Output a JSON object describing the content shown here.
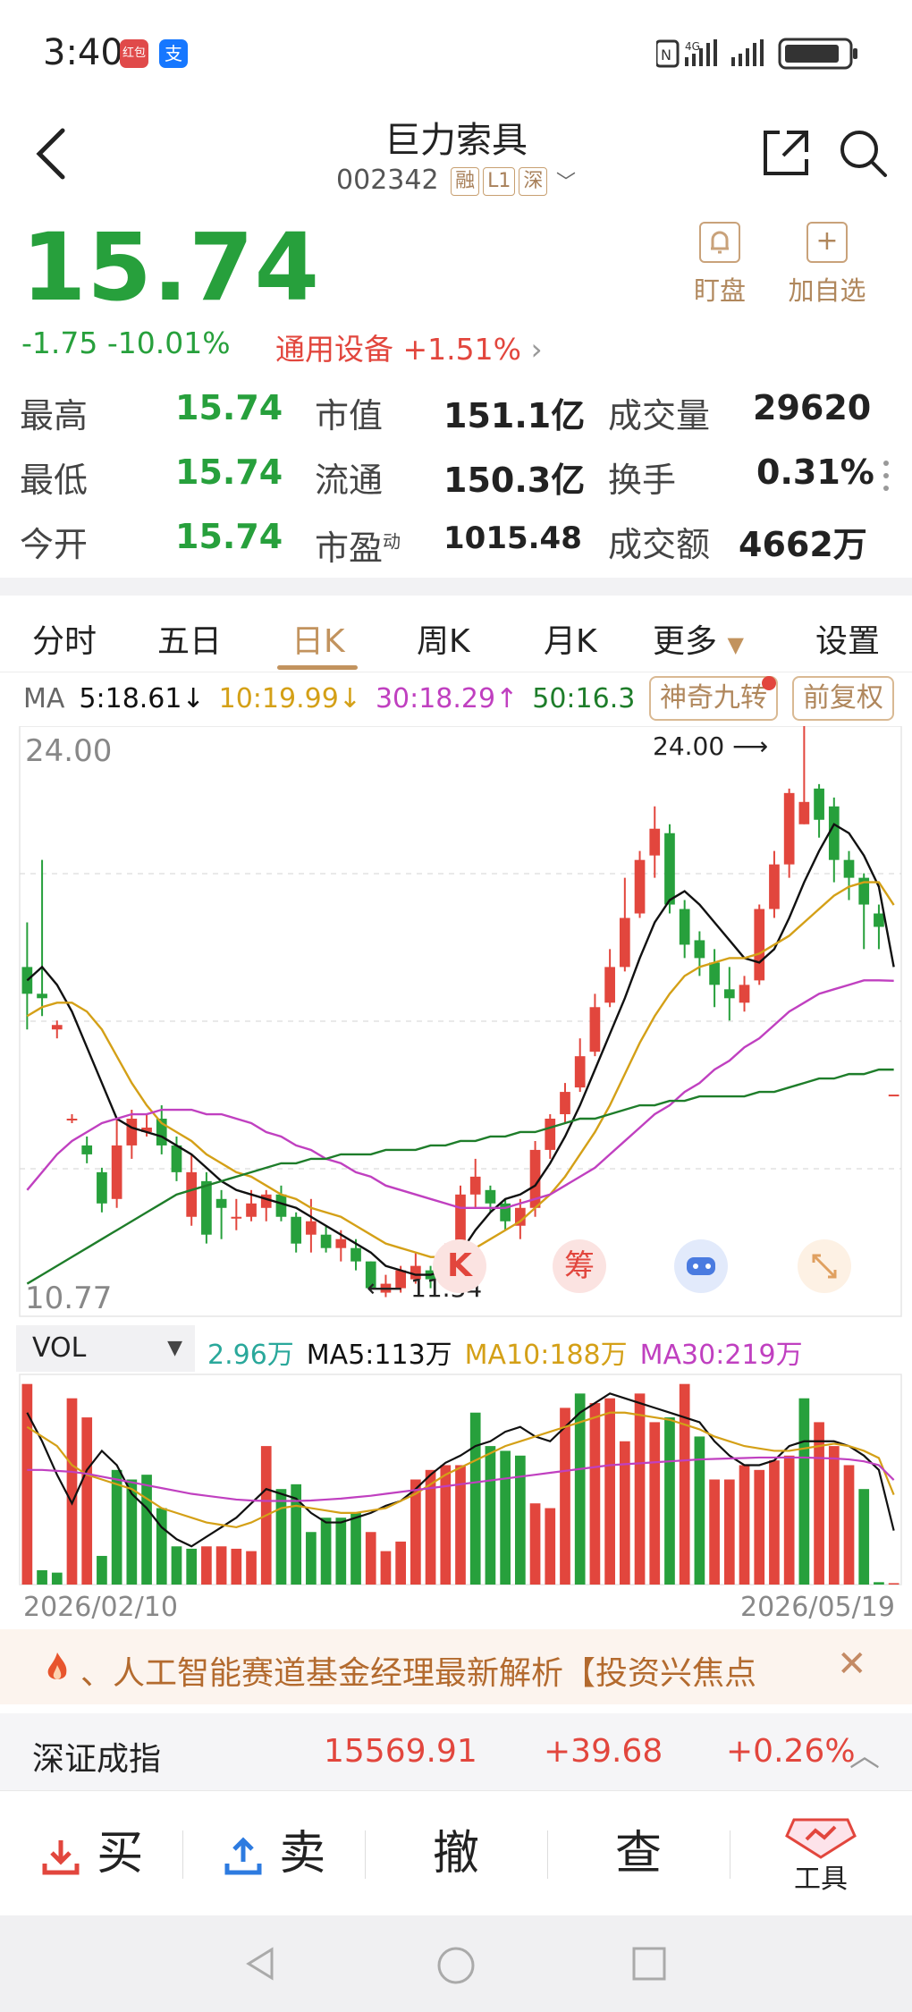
{
  "status": {
    "time": "3:40",
    "app_icon_1": "红包",
    "app_icon_2": "支",
    "network": "4G"
  },
  "header": {
    "stock_name": "巨力索具",
    "stock_code": "002342",
    "tags": [
      "融",
      "L1",
      "深"
    ]
  },
  "quote": {
    "price": "15.74",
    "change": "-1.75 -10.01%",
    "sector": "通用设备 +1.51%",
    "follow_label": "盯盘",
    "add_label": "加自选"
  },
  "stats": {
    "high_label": "最高",
    "high": "15.74",
    "low_label": "最低",
    "low": "15.74",
    "open_label": "今开",
    "open": "15.74",
    "mcap_label": "市值",
    "mcap": "151.1亿",
    "float_label": "流通",
    "float": "150.3亿",
    "pe_label": "市盈",
    "pe_sup": "动",
    "pe": "1015.48",
    "vol_label": "成交量",
    "vol": "29620",
    "turnover_label": "换手",
    "turnover": "0.31%",
    "amount_label": "成交额",
    "amount": "4662万"
  },
  "tabs": [
    "分时",
    "五日",
    "日K",
    "周K",
    "月K",
    "更多",
    "设置"
  ],
  "ma": {
    "label": "MA",
    "ma5": "5:18.61↓",
    "ma10": "10:19.99↓",
    "ma30": "30:18.29↑",
    "ma50": "50:16.3",
    "btn_magic": "神奇九转",
    "btn_adjust": "前复权"
  },
  "chart_labels": {
    "top": "24.00",
    "bottom": "10.77",
    "max_marker": "24.00",
    "min_marker": "11.34",
    "icon_k": "K",
    "icon_chip": "筹"
  },
  "volume": {
    "selector": "VOL",
    "current": "2.96万",
    "ma5": "MA5:113万",
    "ma10": "MA10:188万",
    "ma30": "MA30:219万"
  },
  "dates": {
    "start": "2026/02/10",
    "end": "2026/05/19"
  },
  "news": {
    "text": "、人工智能赛道基金经理最新解析【投资兴焦点"
  },
  "index": {
    "name": "深证成指",
    "value": "15569.91",
    "change": "+39.68",
    "pct": "+0.26%"
  },
  "trade": {
    "buy": "买",
    "sell": "卖",
    "cancel": "撤",
    "query": "查",
    "tools": "工具"
  },
  "colors": {
    "up": "#e2463d",
    "down": "#27a03c",
    "ma5": "#111111",
    "ma10": "#d4a017",
    "ma30": "#c040c0",
    "ma50": "#1e7d2a",
    "accent": "#c2935e"
  },
  "chart_data": [
    {
      "type": "candlestick",
      "title": "",
      "ylim": [
        10.77,
        24.0
      ],
      "x_range": [
        "2026/02/10",
        "2026/05/19"
      ],
      "annotations": {
        "max": 24.0,
        "min": 11.34
      },
      "candles": [
        [
          18.6,
          18.0,
          19.6,
          17.2
        ],
        [
          18.0,
          17.9,
          21.0,
          17.5
        ],
        [
          17.2,
          17.3,
          17.4,
          17.0
        ],
        [
          15.2,
          15.2,
          15.3,
          15.1
        ],
        [
          14.6,
          14.4,
          14.8,
          14.2
        ],
        [
          14.0,
          13.3,
          14.1,
          13.1
        ],
        [
          13.4,
          14.6,
          15.2,
          13.2
        ],
        [
          14.6,
          15.2,
          15.4,
          14.3
        ],
        [
          14.9,
          15.0,
          15.3,
          14.8
        ],
        [
          15.2,
          14.6,
          15.5,
          14.4
        ],
        [
          14.6,
          14.0,
          14.8,
          13.8
        ],
        [
          13.0,
          14.0,
          14.4,
          12.8
        ],
        [
          13.8,
          12.6,
          14.0,
          12.4
        ],
        [
          13.4,
          13.2,
          13.6,
          12.5
        ],
        [
          13.0,
          13.0,
          13.4,
          12.7
        ],
        [
          13.0,
          13.3,
          13.6,
          12.9
        ],
        [
          13.2,
          13.5,
          13.6,
          12.9
        ],
        [
          13.5,
          13.0,
          13.7,
          12.9
        ],
        [
          13.0,
          12.4,
          13.1,
          12.2
        ],
        [
          12.6,
          12.9,
          13.4,
          12.2
        ],
        [
          12.6,
          12.3,
          12.8,
          12.2
        ],
        [
          12.3,
          12.5,
          12.7,
          12.0
        ],
        [
          12.3,
          12.0,
          12.5,
          11.8
        ],
        [
          12.0,
          11.4,
          12.0,
          11.34
        ],
        [
          11.3,
          11.5,
          11.7,
          11.2
        ],
        [
          11.4,
          11.8,
          11.9,
          11.3
        ],
        [
          11.6,
          11.9,
          12.2,
          11.5
        ],
        [
          11.8,
          11.6,
          11.9,
          11.4
        ],
        [
          11.6,
          12.0,
          12.4,
          11.5
        ],
        [
          12.0,
          13.5,
          13.7,
          11.9
        ],
        [
          13.5,
          13.9,
          14.3,
          13.2
        ],
        [
          13.6,
          13.3,
          13.7,
          13.1
        ],
        [
          13.3,
          12.9,
          13.4,
          12.7
        ],
        [
          12.8,
          13.2,
          13.4,
          12.5
        ],
        [
          13.2,
          14.5,
          14.7,
          13.0
        ],
        [
          14.5,
          15.2,
          15.3,
          14.3
        ],
        [
          15.3,
          15.8,
          16.0,
          15.1
        ],
        [
          15.9,
          16.6,
          17.0,
          15.8
        ],
        [
          16.7,
          17.7,
          18.0,
          16.6
        ],
        [
          17.8,
          18.6,
          19.0,
          17.7
        ],
        [
          18.6,
          19.7,
          20.6,
          18.5
        ],
        [
          19.8,
          21.0,
          21.2,
          19.7
        ],
        [
          21.1,
          21.7,
          22.2,
          20.6
        ],
        [
          21.6,
          20.0,
          21.8,
          19.8
        ],
        [
          19.9,
          19.1,
          20.1,
          18.8
        ],
        [
          19.2,
          18.8,
          19.4,
          18.4
        ],
        [
          18.7,
          18.2,
          19.0,
          17.7
        ],
        [
          18.1,
          17.9,
          18.6,
          17.4
        ],
        [
          17.8,
          18.2,
          18.4,
          17.6
        ],
        [
          18.3,
          19.9,
          20.0,
          18.2
        ],
        [
          19.9,
          20.9,
          21.2,
          19.7
        ],
        [
          20.9,
          22.5,
          22.6,
          20.6
        ],
        [
          21.8,
          22.3,
          24.0,
          21.8
        ],
        [
          22.6,
          21.9,
          22.7,
          21.5
        ],
        [
          22.2,
          21.0,
          22.4,
          20.5
        ],
        [
          21.0,
          20.6,
          21.2,
          20.1
        ],
        [
          20.6,
          20.0,
          20.7,
          19.0
        ],
        [
          19.8,
          19.5,
          20.0,
          19.0
        ],
        [
          15.74,
          15.74,
          15.74,
          15.74
        ]
      ],
      "ma_series": [
        {
          "name": "MA5",
          "values": [
            18.3,
            18.6,
            18.2,
            17.6,
            16.8,
            16.0,
            15.2,
            15.0,
            14.9,
            14.8,
            14.6,
            14.4,
            14.1,
            13.8,
            13.6,
            13.5,
            13.4,
            13.3,
            13.2,
            13.0,
            12.8,
            12.6,
            12.4,
            12.2,
            11.9,
            11.8,
            11.7,
            11.7,
            11.8,
            12.2,
            12.7,
            13.1,
            13.4,
            13.5,
            13.7,
            14.2,
            14.8,
            15.5,
            16.3,
            17.1,
            17.9,
            18.8,
            19.6,
            20.1,
            20.3,
            20.0,
            19.6,
            19.2,
            18.8,
            18.7,
            19.0,
            19.7,
            20.5,
            21.2,
            21.8,
            21.6,
            21.1,
            20.4,
            18.6
          ]
        },
        {
          "name": "MA10",
          "values": [
            17.5,
            17.7,
            17.8,
            17.8,
            17.6,
            17.2,
            16.6,
            16.0,
            15.5,
            15.1,
            14.9,
            14.7,
            14.4,
            14.2,
            14.0,
            13.9,
            13.7,
            13.5,
            13.4,
            13.2,
            13.1,
            13.0,
            12.8,
            12.6,
            12.4,
            12.3,
            12.2,
            12.1,
            12.1,
            12.2,
            12.3,
            12.5,
            12.7,
            12.9,
            13.2,
            13.5,
            13.9,
            14.4,
            14.9,
            15.5,
            16.2,
            16.9,
            17.5,
            18.0,
            18.4,
            18.6,
            18.7,
            18.8,
            18.8,
            18.9,
            19.1,
            19.3,
            19.6,
            19.9,
            20.2,
            20.4,
            20.5,
            20.5,
            19.99
          ]
        },
        {
          "name": "MA30",
          "values": [
            13.6,
            14.0,
            14.4,
            14.7,
            14.9,
            15.1,
            15.2,
            15.3,
            15.3,
            15.4,
            15.4,
            15.4,
            15.3,
            15.3,
            15.2,
            15.1,
            14.9,
            14.8,
            14.6,
            14.5,
            14.3,
            14.2,
            14.0,
            13.9,
            13.7,
            13.6,
            13.5,
            13.4,
            13.3,
            13.2,
            13.2,
            13.2,
            13.2,
            13.3,
            13.4,
            13.5,
            13.7,
            13.9,
            14.1,
            14.4,
            14.7,
            15.0,
            15.3,
            15.5,
            15.8,
            16.0,
            16.3,
            16.5,
            16.8,
            17.0,
            17.3,
            17.6,
            17.8,
            18.0,
            18.1,
            18.2,
            18.3,
            18.3,
            18.29
          ]
        },
        {
          "name": "MA50",
          "values": [
            11.5,
            11.7,
            11.9,
            12.1,
            12.3,
            12.5,
            12.7,
            12.9,
            13.1,
            13.3,
            13.5,
            13.6,
            13.7,
            13.8,
            13.9,
            14.0,
            14.1,
            14.2,
            14.2,
            14.3,
            14.3,
            14.4,
            14.4,
            14.4,
            14.5,
            14.5,
            14.5,
            14.6,
            14.6,
            14.7,
            14.7,
            14.8,
            14.8,
            14.9,
            14.9,
            15.0,
            15.1,
            15.2,
            15.2,
            15.3,
            15.4,
            15.5,
            15.5,
            15.6,
            15.6,
            15.7,
            15.7,
            15.7,
            15.7,
            15.8,
            15.8,
            15.9,
            16.0,
            16.1,
            16.1,
            16.2,
            16.2,
            16.3,
            16.3
          ]
        }
      ]
    },
    {
      "type": "bar",
      "title": "",
      "ylabel": "VOL",
      "values_wan": [
        420,
        30,
        25,
        390,
        350,
        60,
        240,
        220,
        230,
        160,
        80,
        75,
        80,
        80,
        75,
        70,
        290,
        200,
        210,
        110,
        140,
        140,
        150,
        110,
        70,
        90,
        220,
        240,
        250,
        250,
        360,
        290,
        280,
        270,
        170,
        160,
        370,
        400,
        380,
        390,
        300,
        400,
        340,
        350,
        420,
        310,
        220,
        220,
        250,
        240,
        260,
        270,
        390,
        340,
        290,
        250,
        200,
        5,
        2.96
      ],
      "colors": [
        "up",
        "down",
        "down",
        "up",
        "up",
        "down",
        "down",
        "down",
        "down",
        "down",
        "down",
        "down",
        "up",
        "up",
        "up",
        "up",
        "up",
        "down",
        "down",
        "down",
        "down",
        "down",
        "down",
        "up",
        "up",
        "up",
        "up",
        "up",
        "up",
        "up",
        "down",
        "down",
        "down",
        "down",
        "up",
        "up",
        "up",
        "down",
        "up",
        "up",
        "up",
        "up",
        "up",
        "down",
        "up",
        "down",
        "up",
        "up",
        "up",
        "up",
        "up",
        "up",
        "down",
        "up",
        "up",
        "up",
        "down",
        "down",
        "up"
      ],
      "ma5_series": [
        360,
        300,
        230,
        170,
        240,
        280,
        250,
        190,
        160,
        120,
        95,
        80,
        100,
        120,
        140,
        170,
        200,
        190,
        180,
        150,
        130,
        130,
        140,
        150,
        165,
        175,
        200,
        230,
        255,
        270,
        290,
        300,
        320,
        330,
        310,
        300,
        330,
        360,
        380,
        400,
        390,
        380,
        370,
        360,
        350,
        340,
        300,
        270,
        250,
        250,
        260,
        290,
        300,
        300,
        300,
        290,
        270,
        240,
        113
      ],
      "ma10_series": [
        330,
        310,
        290,
        250,
        230,
        220,
        210,
        200,
        180,
        160,
        150,
        140,
        130,
        125,
        120,
        130,
        145,
        160,
        165,
        160,
        155,
        150,
        150,
        155,
        160,
        175,
        190,
        210,
        230,
        245,
        260,
        275,
        290,
        300,
        310,
        320,
        330,
        340,
        350,
        360,
        360,
        355,
        350,
        345,
        335,
        325,
        310,
        300,
        290,
        285,
        280,
        280,
        285,
        290,
        295,
        290,
        280,
        265,
        188
      ],
      "ma30_series": [
        240,
        240,
        238,
        236,
        232,
        226,
        220,
        214,
        208,
        202,
        196,
        190,
        186,
        182,
        178,
        176,
        175,
        175,
        175,
        176,
        178,
        180,
        183,
        186,
        190,
        194,
        198,
        202,
        206,
        210,
        214,
        218,
        222,
        226,
        230,
        234,
        238,
        242,
        246,
        250,
        252,
        254,
        256,
        258,
        260,
        262,
        263,
        264,
        265,
        266,
        266,
        266,
        266,
        265,
        264,
        262,
        258,
        250,
        219
      ]
    }
  ]
}
